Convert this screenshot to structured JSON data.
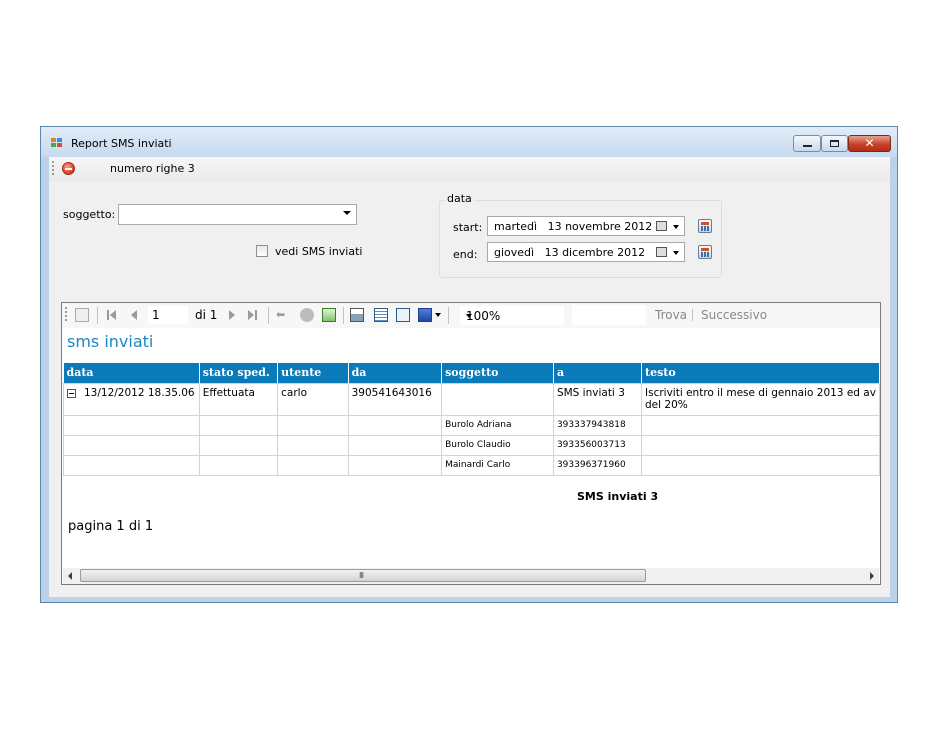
{
  "window": {
    "title": "Report SMS inviati"
  },
  "topbar": {
    "rows_label": "numero righe 3"
  },
  "filters": {
    "soggetto_label": "soggetto:",
    "soggetto_value": "",
    "vedi_label": "vedi SMS inviati",
    "group_title": "data",
    "start_label": "start:",
    "start_value": "martedì   13 novembre 2012",
    "end_label": "end:",
    "end_value": "giovedì   13 dicembre 2012"
  },
  "report_toolbar": {
    "page_value": "1",
    "page_of": "di 1",
    "zoom": "100%",
    "find_label": "Trova",
    "next_label": "Successivo"
  },
  "report": {
    "title": "sms inviati",
    "columns": [
      "data",
      "stato sped.",
      "utente",
      "da",
      "soggetto",
      "a",
      "testo"
    ],
    "row": {
      "data": "13/12/2012 18.35.06",
      "stato": "Effettuata",
      "utente": "carlo",
      "da": "390541643016",
      "soggetto": "",
      "a": "SMS inviati 3",
      "testo_line1": "Iscriviti entro il mese di gennaio 2013 ed av",
      "testo_line2": "del 20%"
    },
    "recipients": [
      {
        "name": "Burolo Adriana",
        "number": "393337943818"
      },
      {
        "name": "Burolo Claudio",
        "number": "393356003713"
      },
      {
        "name": "Mainardi Carlo",
        "number": "393396371960"
      }
    ],
    "total_label": "SMS inviati 3",
    "footer": "pagina 1 di 1"
  },
  "scrollbar": {
    "grip": "III"
  },
  "colors": {
    "header": "#0b7ab8",
    "title": "#1d86c6"
  },
  "icons": [
    "app-icon",
    "stop-icon",
    "calendar-icon",
    "first-page-icon",
    "prev-page-icon",
    "next-page-icon",
    "last-page-icon",
    "back-icon",
    "stop-render-icon",
    "refresh-icon",
    "print-icon",
    "print-layout-icon",
    "page-setup-icon",
    "export-icon"
  ]
}
